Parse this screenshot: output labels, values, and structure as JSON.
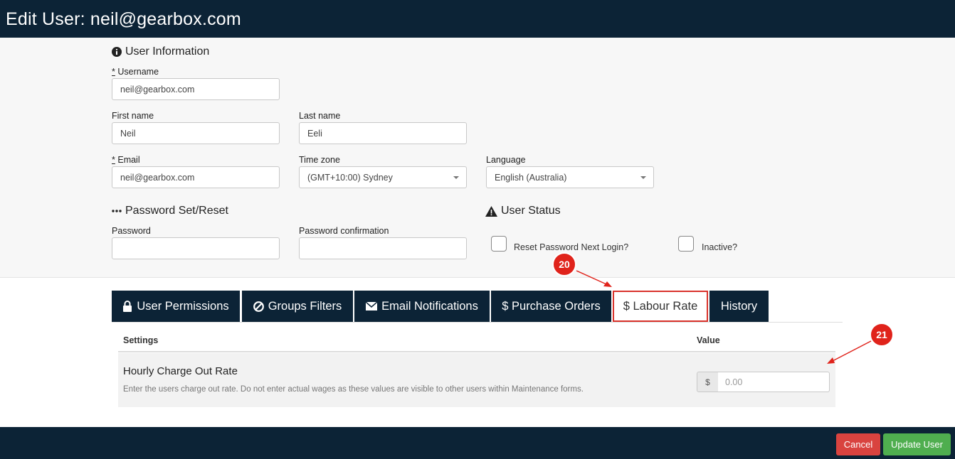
{
  "header": {
    "title": "Edit User: neil@gearbox.com"
  },
  "user_info": {
    "title": "User Information",
    "username_label": "Username",
    "username_value": "neil@gearbox.com",
    "first_name_label": "First name",
    "first_name_value": "Neil",
    "last_name_label": "Last name",
    "last_name_value": "Eeli",
    "email_label": "Email",
    "email_value": "neil@gearbox.com",
    "timezone_label": "Time zone",
    "timezone_value": "(GMT+10:00) Sydney",
    "language_label": "Language",
    "language_value": "English (Australia)",
    "required_marker": "*"
  },
  "password": {
    "title": "Password Set/Reset",
    "password_label": "Password",
    "confirm_label": "Password confirmation"
  },
  "status": {
    "title": "User Status",
    "reset_label": "Reset Password Next Login?",
    "inactive_label": "Inactive?"
  },
  "tabs": [
    {
      "label": "User Permissions",
      "icon": "lock-icon"
    },
    {
      "label": "Groups Filters",
      "icon": "ban-icon"
    },
    {
      "label": "Email Notifications",
      "icon": "envelope-icon"
    },
    {
      "label": "$ Purchase Orders",
      "icon": ""
    },
    {
      "label": "$ Labour Rate",
      "icon": ""
    },
    {
      "label": "History",
      "icon": ""
    }
  ],
  "active_tab": "$ Labour Rate",
  "table": {
    "settings_header": "Settings",
    "value_header": "Value",
    "row_title": "Hourly Charge Out Rate",
    "row_desc": "Enter the users charge out rate. Do not enter actual wages as these values are visible to other users within Maintenance forms.",
    "currency": "$",
    "rate_placeholder": "0.00"
  },
  "footer": {
    "cancel_label": "Cancel",
    "update_label": "Update User"
  },
  "callouts": [
    "20",
    "21"
  ],
  "colors": {
    "header_bg": "#0c2336",
    "accent_red": "#d9322b",
    "cancel": "#d9433f",
    "update": "#4fae4f"
  }
}
